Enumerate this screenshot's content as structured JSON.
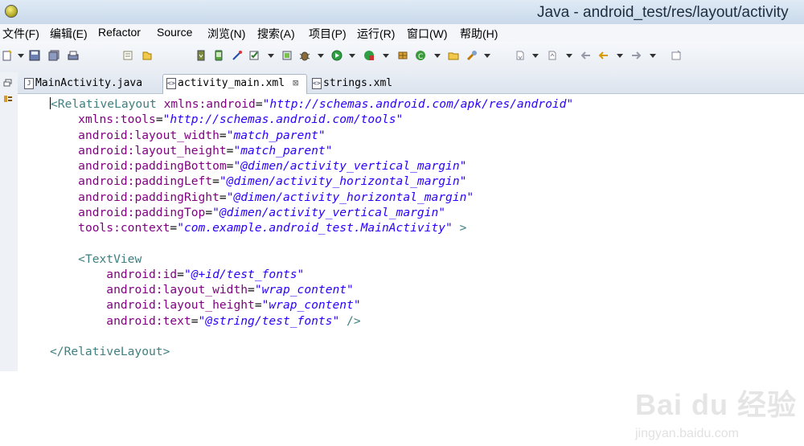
{
  "window": {
    "title": "Java - android_test/res/layout/activity"
  },
  "menu": [
    "文件(F)",
    "编辑(E)",
    "Refactor",
    "Source",
    "浏览(N)",
    "搜索(A)",
    "项目(P)",
    "运行(R)",
    "窗口(W)",
    "帮助(H)"
  ],
  "tabs": [
    {
      "label": "MainActivity.java",
      "icon": "java-file-icon",
      "active": false
    },
    {
      "label": "activity_main.xml",
      "icon": "xml-file-icon",
      "active": true,
      "close": "⊠"
    },
    {
      "label": "strings.xml",
      "icon": "xml-file-icon",
      "active": false
    }
  ],
  "code": [
    [
      [
        "tag",
        "<RelativeLayout "
      ],
      [
        "attr",
        "xmlns:android"
      ],
      [
        "eq",
        "="
      ],
      [
        "val",
        "\"http://schemas.android.com/apk/res/android\""
      ]
    ],
    [
      [
        "sp",
        "    "
      ],
      [
        "attr",
        "xmlns:tools"
      ],
      [
        "eq",
        "="
      ],
      [
        "val",
        "\"http://schemas.android.com/tools\""
      ]
    ],
    [
      [
        "sp",
        "    "
      ],
      [
        "attr",
        "android:layout_width"
      ],
      [
        "eq",
        "="
      ],
      [
        "val",
        "\"match_parent\""
      ]
    ],
    [
      [
        "sp",
        "    "
      ],
      [
        "attr",
        "android:layout_height"
      ],
      [
        "eq",
        "="
      ],
      [
        "val",
        "\"match_parent\""
      ]
    ],
    [
      [
        "sp",
        "    "
      ],
      [
        "attr",
        "android:paddingBottom"
      ],
      [
        "eq",
        "="
      ],
      [
        "val",
        "\"@dimen/activity_vertical_margin\""
      ]
    ],
    [
      [
        "sp",
        "    "
      ],
      [
        "attr",
        "android:paddingLeft"
      ],
      [
        "eq",
        "="
      ],
      [
        "val",
        "\"@dimen/activity_horizontal_margin\""
      ]
    ],
    [
      [
        "sp",
        "    "
      ],
      [
        "attr",
        "android:paddingRight"
      ],
      [
        "eq",
        "="
      ],
      [
        "val",
        "\"@dimen/activity_horizontal_margin\""
      ]
    ],
    [
      [
        "sp",
        "    "
      ],
      [
        "attr",
        "android:paddingTop"
      ],
      [
        "eq",
        "="
      ],
      [
        "val",
        "\"@dimen/activity_vertical_margin\""
      ]
    ],
    [
      [
        "sp",
        "    "
      ],
      [
        "attr",
        "tools:context"
      ],
      [
        "eq",
        "="
      ],
      [
        "val",
        "\"com.example.android_test.MainActivity\""
      ],
      [
        "tag",
        " >"
      ]
    ],
    [],
    [
      [
        "sp",
        "    "
      ],
      [
        "tag",
        "<TextView"
      ]
    ],
    [
      [
        "sp",
        "        "
      ],
      [
        "attr",
        "android:id"
      ],
      [
        "eq",
        "="
      ],
      [
        "val",
        "\"@+id/test_fonts\""
      ]
    ],
    [
      [
        "sp",
        "        "
      ],
      [
        "attr",
        "android:layout_width"
      ],
      [
        "eq",
        "="
      ],
      [
        "val",
        "\"wrap_content\""
      ]
    ],
    [
      [
        "sp",
        "        "
      ],
      [
        "attr",
        "android:layout_height"
      ],
      [
        "eq",
        "="
      ],
      [
        "val",
        "\"wrap_content\""
      ]
    ],
    [
      [
        "sp",
        "        "
      ],
      [
        "attr",
        "android:text"
      ],
      [
        "eq",
        "="
      ],
      [
        "val",
        "\"@string/test_fonts\""
      ],
      [
        "tag",
        " />"
      ]
    ],
    [],
    [
      [
        "tag",
        "</RelativeLayout>"
      ]
    ]
  ],
  "watermark": {
    "main": "Bai du 经验",
    "sub": "jingyan.baidu.com"
  },
  "colors": {
    "tag": "#3f7f7f",
    "attribute": "#7f007f",
    "value": "#2a00ff"
  }
}
